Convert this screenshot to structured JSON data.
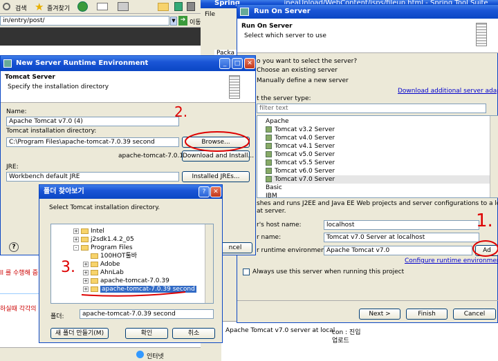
{
  "browser": {
    "search_label": "검색",
    "favorites_label": "즐겨찾기",
    "address": "in/entry/post/",
    "go_label": "이동",
    "status_zone": "인터넷"
  },
  "spring": {
    "title": "Spring",
    "file_menu": "File",
    "package_tab": "Packa",
    "editor_title_fragment": "ineaUnload/WebContent/jsps/fileup.html - Spring Tool Suite",
    "console_line1": "Apache Tomcat v7.0 server at local",
    "console_line2": "con : 진입",
    "console_line3": "업로드"
  },
  "blog": {
    "text1": "ll 를 수행해 줍",
    "text2": "하실때 각각의"
  },
  "run_on_server": {
    "title": "Run On Server",
    "heading": "Run On Server",
    "subtitle": "Select which server to use",
    "question": "o you want to select the server?",
    "opt_existing": "Choose an existing server",
    "opt_manual": "Manually define a new server",
    "download_link": "Download additional server adapters",
    "type_label": "t the server type:",
    "filter_placeholder": "filter text",
    "group_apache": "Apache",
    "servers": [
      "Tomcat v3.2 Server",
      "Tomcat v4.0 Server",
      "Tomcat v4.1 Server",
      "Tomcat v5.0 Server",
      "Tomcat v5.5 Server",
      "Tomcat v6.0 Server",
      "Tomcat v7.0 Server"
    ],
    "group_basic": "Basic",
    "group_ibm": "IBM",
    "description": "shes and runs J2EE and Java EE Web projects and server configurations to a local",
    "description2": "at server.",
    "host_label": "r's host name:",
    "host_value": "localhost",
    "name_label": "r name:",
    "name_value": "Tomcat v7.0 Server at localhost",
    "runtime_label": "r runtime environment:",
    "runtime_value": "Apache Tomcat v7.0",
    "add_label": "Ad",
    "configure_link": "Configure runtime environments...",
    "always_label": "Always use this server when running this project",
    "next_label": "Next >",
    "finish_label": "Finish",
    "cancel_label": "Cancel"
  },
  "new_runtime": {
    "title": "New Server Runtime Environment",
    "heading": "Tomcat Server",
    "subtitle": "Specify the installation directory",
    "name_label": "Name:",
    "name_value": "Apache Tomcat v7.0 (4)",
    "dir_label": "Tomcat installation directory:",
    "dir_value": "C:\\Program Files\\apache-tomcat-7.0.39 second",
    "browse_label": "Browse...",
    "version_text": "apache-tomcat-7.0.12",
    "download_label": "Download and Install...",
    "jre_label": "JRE:",
    "jre_value": "Workbench default JRE",
    "installed_jres_label": "Installed JREs...",
    "help_label": "?",
    "cancel_label": "ncel"
  },
  "folder_dialog": {
    "title": "폴더 찾아보기",
    "instruction": "Select Tomcat installation directory.",
    "tree": [
      {
        "label": "Intel",
        "expander": "+",
        "indent": 0
      },
      {
        "label": "j2sdk1.4.2_05",
        "expander": "+",
        "indent": 0
      },
      {
        "label": "Program Files",
        "expander": "-",
        "indent": 0
      },
      {
        "label": "100HOT툴바",
        "expander": "",
        "indent": 1
      },
      {
        "label": "Adobe",
        "expander": "+",
        "indent": 1
      },
      {
        "label": "AhnLab",
        "expander": "+",
        "indent": 1
      },
      {
        "label": "apache-tomcat-7.0.39",
        "expander": "+",
        "indent": 1
      },
      {
        "label": "apache-tomcat-7.0.39 second",
        "expander": "+",
        "indent": 1
      }
    ],
    "folder_label": "폴더:",
    "folder_value": "apache-tomcat-7.0.39 second",
    "new_folder_label": "새 폴더 만들기(M)",
    "ok_label": "확인",
    "cancel_label": "취소"
  },
  "annotations": {
    "step1": "1.",
    "step2": "2.",
    "step3": "3."
  },
  "colors": {
    "title_bar": "#0a46c4",
    "dialog_bg": "#ece9d8",
    "annotation": "#dd0000",
    "selection": "#316ac5"
  }
}
